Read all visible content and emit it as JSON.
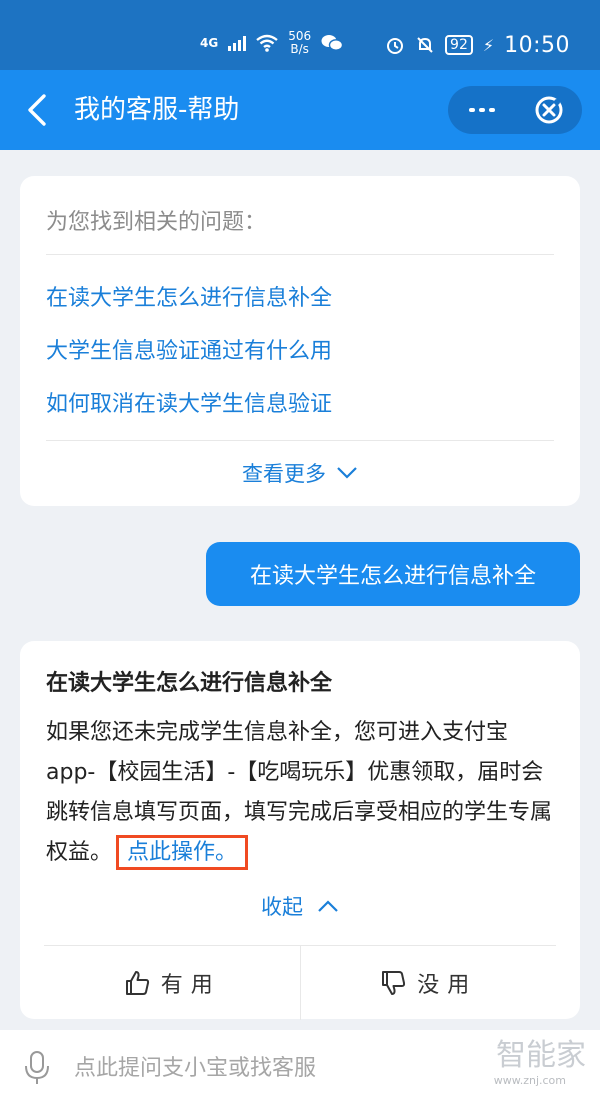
{
  "status_bar": {
    "network": "4G",
    "speed_value": "506",
    "speed_unit": "B/s",
    "battery": "92",
    "time": "10:50"
  },
  "header": {
    "title": "我的客服-帮助",
    "icons": [
      "back-arrow-icon",
      "more-dots-icon",
      "close-circle-icon"
    ]
  },
  "related": {
    "title": "为您找到相关的问题：",
    "questions": [
      "在读大学生怎么进行信息补全",
      "大学生信息验证通过有什么用",
      "如何取消在读大学生信息验证"
    ],
    "see_more": "查看更多"
  },
  "user_message": "在读大学生怎么进行信息补全",
  "answer": {
    "title": "在读大学生怎么进行信息补全",
    "body": "如果您还未完成学生信息补全，您可进入支付宝app-【校园生活】-【吃喝玩乐】优惠领取，届时会跳转信息填写页面，填写完成后享受相应的学生专属权益。",
    "action_link": "点此操作。",
    "collapse": "收起",
    "useful": "有用",
    "useless": "没用"
  },
  "input": {
    "placeholder": "点此提问支小宝或找客服"
  },
  "watermark": {
    "text": "智能家",
    "url": "www.znj.com"
  },
  "colors": {
    "status_bar": "#1d73c2",
    "header": "#1a8cf0",
    "link": "#1a7fd9",
    "highlight_border": "#f04a22"
  }
}
